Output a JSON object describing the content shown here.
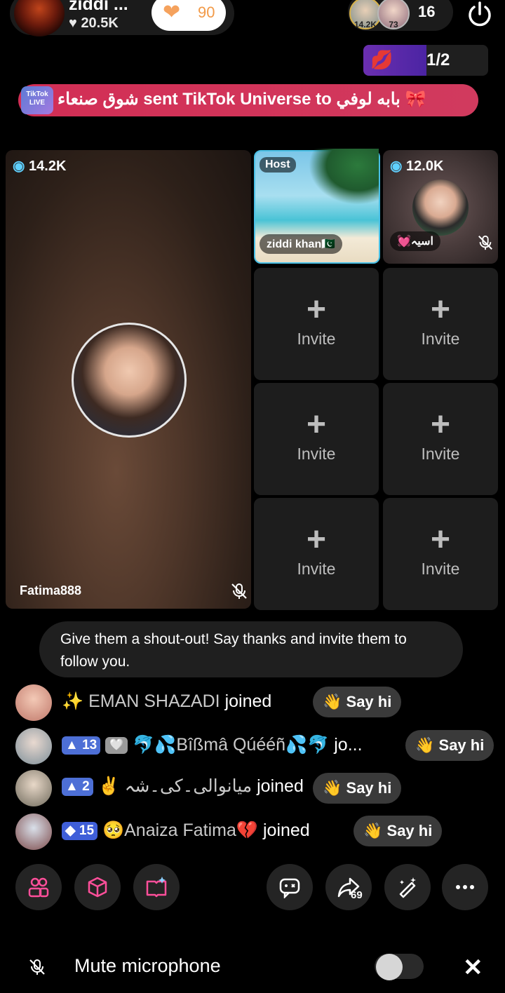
{
  "header": {
    "host_name": "ziddi ...",
    "host_likes": "20.5K",
    "follow_count": "90",
    "viewer_badge_1": "14.2K",
    "viewer_badge_2": "73",
    "viewer_count": "16"
  },
  "gift_progress": {
    "page": "1/2",
    "progress": 0.5
  },
  "banner": {
    "logo_text": "TikTok LIVE",
    "text": "شوق صنعاء sent TikTok Universe to بابه لوفي"
  },
  "main_tile": {
    "badge": "14.2K",
    "name": "Fatima888"
  },
  "host_tile": {
    "tag": "Host",
    "name": "ziddi khan🇵🇰"
  },
  "guest_tile": {
    "badge": "12.0K",
    "name": "💓اسیہ"
  },
  "invite_tiles": [
    {
      "label": "Invite"
    },
    {
      "label": "Invite"
    },
    {
      "label": "Invite"
    },
    {
      "label": "Invite"
    },
    {
      "label": "Invite"
    },
    {
      "label": "Invite"
    }
  ],
  "tip": "Give them a shout-out! Say thanks and invite them to follow you.",
  "joins": [
    {
      "name": "✨ EMAN SHAZADI",
      "action": "joined",
      "level": "",
      "say_hi": "Say hi"
    },
    {
      "name": "🐬💦Bîßmâ Qúééñ💦🐬",
      "action": "jo...",
      "level": "13",
      "say_hi": "Say hi"
    },
    {
      "name": "✌️ میانوالی۔کی۔شہ",
      "action": "joined",
      "level": "2",
      "say_hi": "Say hi"
    },
    {
      "name": "🥺Anaiza Fatima💔",
      "action": "joined",
      "level": "15",
      "say_hi": "Say hi"
    }
  ],
  "toolbar": {
    "share_count": "69"
  },
  "bottom": {
    "mute_label": "Mute microphone",
    "toggle_on": false
  },
  "colors": {
    "banner": "#d22e55",
    "accent_purple": "#6b2fb0",
    "host_border": "#49c0e6"
  }
}
